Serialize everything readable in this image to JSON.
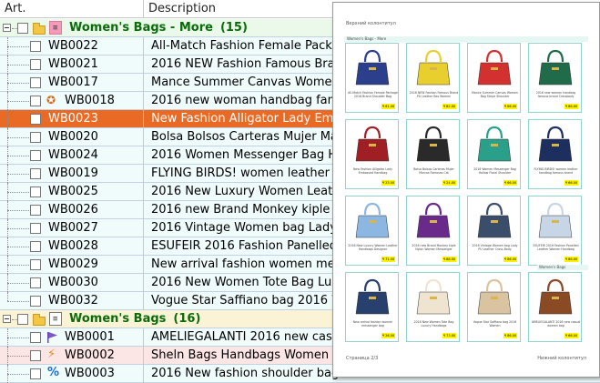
{
  "header": {
    "col_art": "Art.",
    "col_desc": "Description"
  },
  "groups": [
    {
      "title": "Women's Bags - More",
      "count": "(15)",
      "icon": "grid-icon"
    },
    {
      "title": "Women's Bags",
      "count": "(16)",
      "icon": "grid-icon"
    }
  ],
  "rows": [
    {
      "art": "WB0022",
      "desc": "All-Match Fashion Female Package"
    },
    {
      "art": "WB0021",
      "desc": "2016 NEW Fashion Famous Brand"
    },
    {
      "art": "WB0017",
      "desc": "Mance Summer Canvas Women Bag"
    },
    {
      "art": "WB0018",
      "desc": "2016 new woman handbag famous"
    },
    {
      "art": "WB0023",
      "desc": "New Fashion Alligator Lady Embos"
    },
    {
      "art": "WB0020",
      "desc": "Bolsa Bolsos Carteras Mujer Marc"
    },
    {
      "art": "WB0024",
      "desc": "2016 Women Messenger Bag Holl"
    },
    {
      "art": "WB0019",
      "desc": "FLYING BIRDS! women leather ha"
    },
    {
      "art": "WB0025",
      "desc": "2016 New Luxury Women Leather"
    },
    {
      "art": "WB0026",
      "desc": "2016 new Brand Monkey kiple Nyl"
    },
    {
      "art": "WB0027",
      "desc": "2016 Vintage Women bag Lady PU"
    },
    {
      "art": "WB0028",
      "desc": "ESUFEIR 2016 Fashion Panelled L"
    },
    {
      "art": "WB0029",
      "desc": "New arrival fashion women messe"
    },
    {
      "art": "WB0030",
      "desc": "2016 New Women Tote Bag Luxury"
    },
    {
      "art": "WB0032",
      "desc": "Vogue Star Saffiano bag 2016 Wo"
    }
  ],
  "rows2": [
    {
      "art": "WB0001",
      "desc": "AMELIEGALANTI 2016 new casua"
    },
    {
      "art": "WB0002",
      "desc": "Sheln Bags Handbags Women Fa"
    },
    {
      "art": "WB0003",
      "desc": "2016 New fashion shoulder bags h"
    }
  ],
  "preview": {
    "header_text": "Верхний колонтитул",
    "band_label": "Women's Bags - More",
    "band2_label": "Women's Bags",
    "footer_left": "Страница 2/3",
    "footer_right": "Нижний колонтитул",
    "cards": [
      {
        "cap": "All-Match Fashion Female Package 2016 Brand Shoulder Bag",
        "price": "₹ 61.00",
        "color": "#2b3f8c"
      },
      {
        "cap": "2016 NEW Fashion Famous Brand PU Leather Bas Women",
        "price": "₹ 82.00",
        "color": "#e8cf2e"
      },
      {
        "cap": "Mance Summer Canvas Women Bag Stripe Shoulder",
        "price": "₹ 66.00",
        "color": "#d33030"
      },
      {
        "cap": "2016 new woman handbag famous brand Crossbody",
        "price": "₹ 86.00",
        "color": "#1f6b4a"
      },
      {
        "cap": "New Fashion Alligator Lady Embossed Handbag",
        "price": "₹ 23.00",
        "color": "#a01f25"
      },
      {
        "cap": "Bolsa Bolsos Carteras Mujer Marcas Famosas Cat",
        "price": "₹ 24.00",
        "color": "#2a2a2a"
      },
      {
        "cap": "2016 Women Messenger Bag Hollow Floral Shoulder",
        "price": "₹ 66.00",
        "color": "#2a9f8a"
      },
      {
        "cap": "FLYING BIRDS! women leather handbag famous brand",
        "price": "₹ 66.00",
        "color": "#1d2f5e"
      },
      {
        "cap": "2016 New Luxury Women Leather Handbags Designer",
        "price": "₹ 71.00",
        "color": "#8cb7e3"
      },
      {
        "cap": "2016 new Brand Monkey kiple Nylon Women Messenger",
        "price": "₹ 88.00",
        "color": "#6a2a8c"
      },
      {
        "cap": "2016 Vintage Women bag Lady PU Leather Cross Body",
        "price": "₹ 86.00",
        "color": "#3a4d6a"
      },
      {
        "cap": "ESUFEIR 2016 Fashion Panelled Leather Women Handbag",
        "price": "₹ 86.00",
        "color": "#c7d6e6"
      },
      {
        "cap": "New arrival fashion women messenger bag",
        "price": "₹ 26.00",
        "color": "#27406d"
      },
      {
        "cap": "2016 New Women Tote Bag Luxury Handbags",
        "price": "₹ 73.00",
        "color": "#efe4cf"
      },
      {
        "cap": "Vogue Star Saffiano bag 2016 Women",
        "price": "₹ 86.00",
        "color": "#d9c3a0"
      },
      {
        "cap": "AMELIEGALANTI 2016 new casual women bag",
        "price": "₹ 66.00",
        "color": "#8a4a24"
      }
    ]
  },
  "colors": {
    "selected_row": "#e96a24",
    "group1_bg": "#eaf9e9",
    "group2_bg": "#fbf3d6",
    "item_bg": "#f0fbfb",
    "group_title": "#0b6b0b"
  }
}
